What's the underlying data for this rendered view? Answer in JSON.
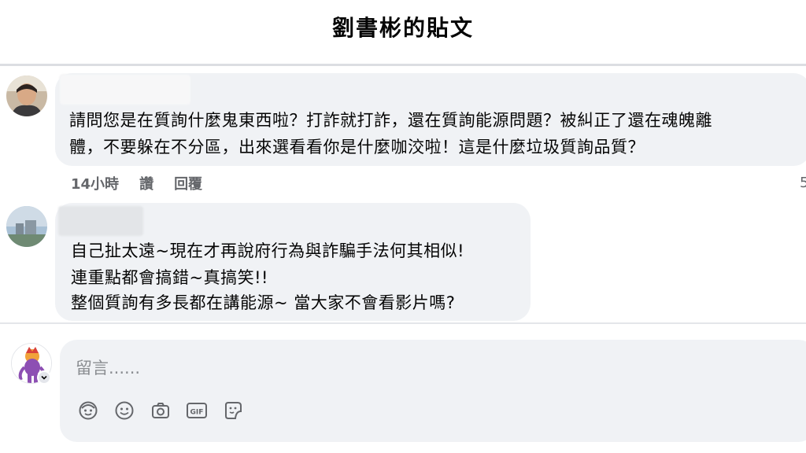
{
  "header": {
    "title": "劉書彬的貼文"
  },
  "comments": [
    {
      "lines": [
        "請問您是在質詢什麼鬼東西啦？打詐就打詐，還在質詢能源問題？被糾正了還在魂魄離",
        "體，不要躲在不分區，出來選看看你是什麼咖洨啦！這是什麼垃圾質詢品質？"
      ],
      "time": "14小時",
      "like_label": "讚",
      "reply_label": "回覆",
      "edge_text": "5"
    },
    {
      "lines": [
        "自己扯太遠~現在才再說府行為與詐騙手法何其相似!",
        "連重點都會搞錯~真搞笑!!",
        "整個質詢有多長都在講能源~ 當大家不會看影片嗎?"
      ]
    }
  ],
  "composer": {
    "placeholder": "留言......",
    "icons": [
      "avatar-sticker-icon",
      "emoji-icon",
      "camera-icon",
      "gif-icon",
      "sticker-icon"
    ]
  }
}
